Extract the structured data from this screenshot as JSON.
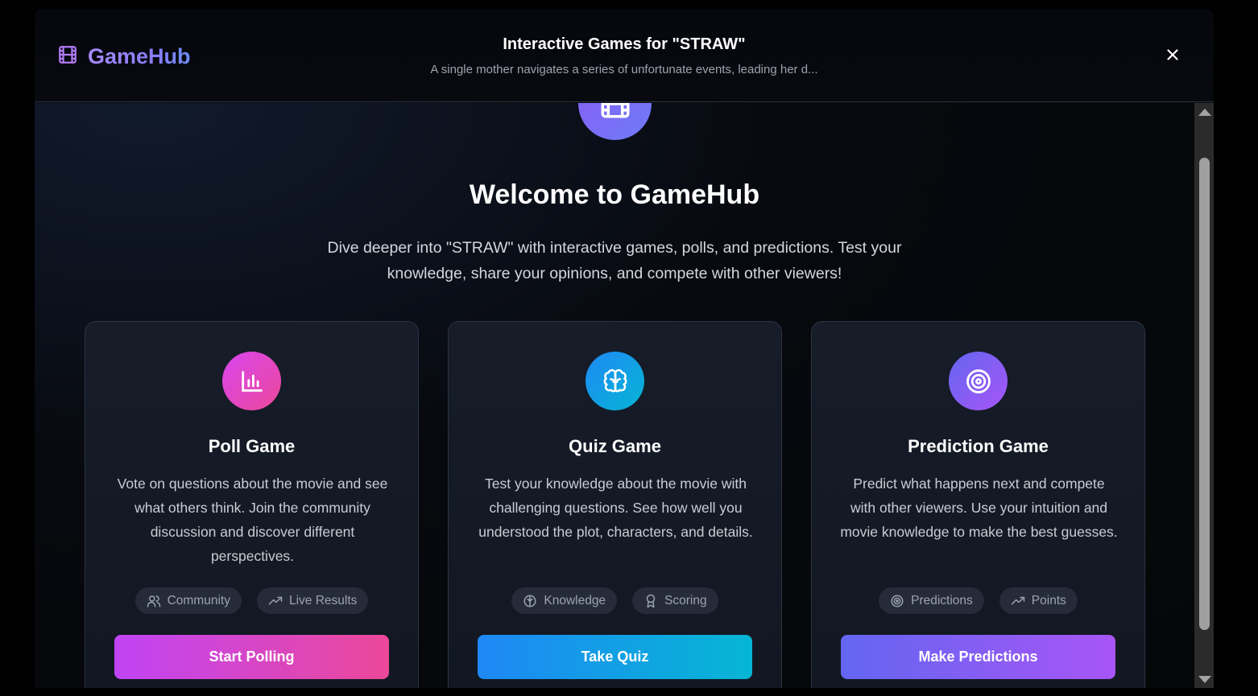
{
  "header": {
    "brand": "GameHub",
    "title": "Interactive Games for \"STRAW\"",
    "subtitle": "A single mother navigates a series of unfortunate events, leading her d..."
  },
  "hero": {
    "heading": "Welcome to GameHub",
    "description": "Dive deeper into \"STRAW\" with interactive games, polls, and predictions. Test your knowledge, share your opinions, and compete with other viewers!"
  },
  "cards": [
    {
      "title": "Poll Game",
      "description": "Vote on questions about the movie and see what others think. Join the community discussion and discover different perspectives.",
      "tags": [
        "Community",
        "Live Results"
      ],
      "button": "Start Polling",
      "icon": "bar-chart-icon",
      "gradient": [
        "#d946ef",
        "#ec4899"
      ]
    },
    {
      "title": "Quiz Game",
      "description": "Test your knowledge about the movie with challenging questions. See how well you understood the plot, characters, and details.",
      "tags": [
        "Knowledge",
        "Scoring"
      ],
      "button": "Take Quiz",
      "icon": "brain-icon",
      "gradient": [
        "#1e88f5",
        "#06b6d4"
      ]
    },
    {
      "title": "Prediction Game",
      "description": "Predict what happens next and compete with other viewers. Use your intuition and movie knowledge to make the best guesses.",
      "tags": [
        "Predictions",
        "Points"
      ],
      "button": "Make Predictions",
      "icon": "target-icon",
      "gradient": [
        "#6366f1",
        "#a855f7"
      ]
    }
  ],
  "colors": {
    "poll_button": [
      "#c044f5",
      "#ec4899"
    ],
    "quiz_button": [
      "#1e88f5",
      "#06b6d4"
    ],
    "prediction_button": [
      "#6366f1",
      "#a855f7"
    ]
  }
}
